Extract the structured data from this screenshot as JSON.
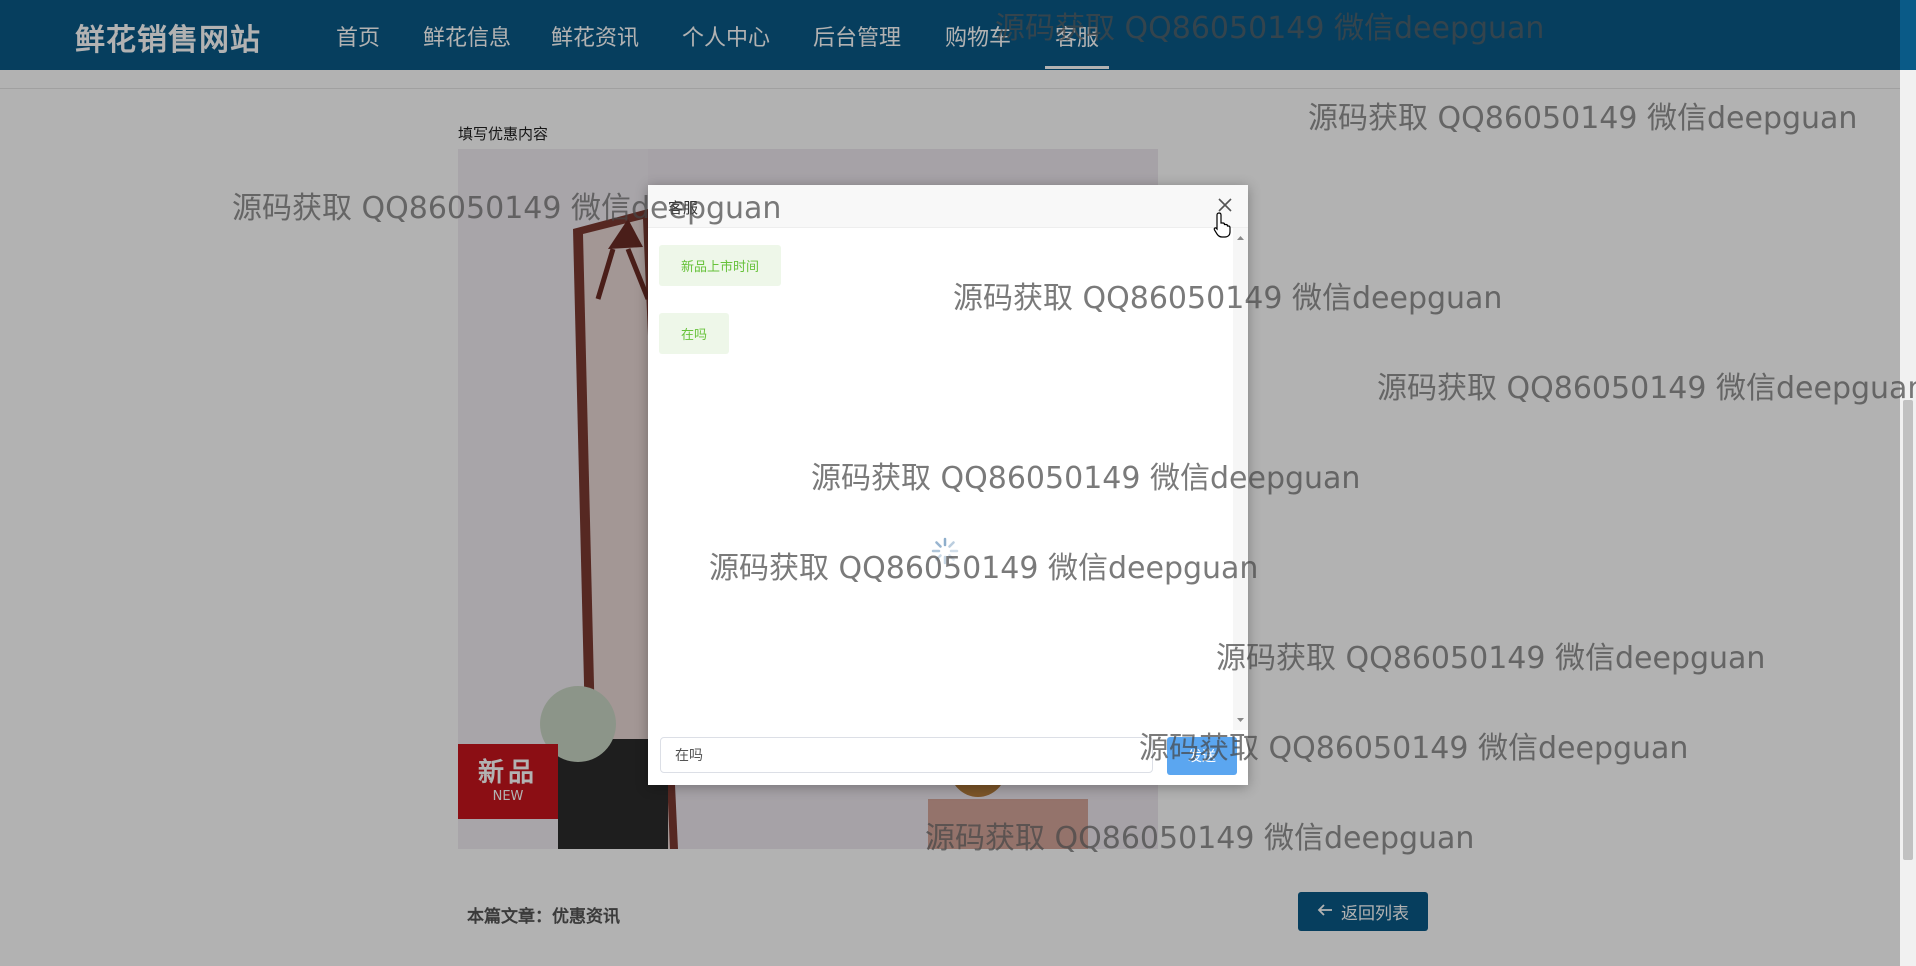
{
  "header": {
    "brand": "鲜花销售网站",
    "nav": [
      {
        "label": "首页"
      },
      {
        "label": "鲜花信息"
      },
      {
        "label": "鲜花资讯"
      },
      {
        "label": "个人中心"
      },
      {
        "label": "后台管理"
      },
      {
        "label": "购物车"
      },
      {
        "label": "客服"
      }
    ],
    "active_nav": "客服"
  },
  "article": {
    "content_label": "填写优惠内容",
    "badge": {
      "main": "新品",
      "sub": "NEW"
    },
    "footer_label": "本篇文章：优惠资讯",
    "back_button": "返回列表"
  },
  "dialog": {
    "title": "客服",
    "messages": [
      {
        "text": "新品上市时间"
      },
      {
        "text": "在吗"
      }
    ],
    "input_value": "在吗",
    "send_label": "发送"
  },
  "watermark_text": "源码获取 QQ86050149 微信deepguan",
  "colors": {
    "nav_bg": "#0a5a87",
    "message_bg": "#eef7e9",
    "message_text": "#67c23a",
    "send_button": "#5ba6f0"
  }
}
